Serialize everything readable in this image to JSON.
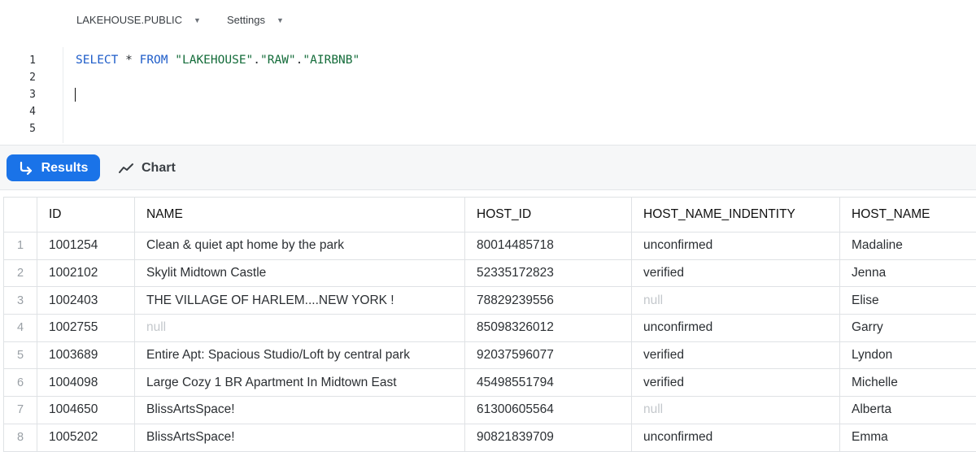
{
  "context": {
    "database_schema": "LAKEHOUSE.PUBLIC",
    "settings_label": "Settings"
  },
  "editor": {
    "line_numbers": [
      "1",
      "2",
      "3",
      "4",
      "5"
    ],
    "query": {
      "select": "SELECT",
      "star": "*",
      "from": "FROM",
      "db": "\"LAKEHOUSE\"",
      "dot": ".",
      "schema": "\"RAW\"",
      "table": "\"AIRBNB\""
    }
  },
  "tabs": {
    "results_label": "Results",
    "chart_label": "Chart"
  },
  "table": {
    "columns": [
      "ID",
      "NAME",
      "HOST_ID",
      "HOST_NAME_INDENTITY",
      "HOST_NAME"
    ],
    "rows": [
      {
        "n": "1",
        "id": "1001254",
        "name": "Clean & quiet apt home by the park",
        "host_id": "80014485718",
        "identity": "unconfirmed",
        "host_name": "Madaline"
      },
      {
        "n": "2",
        "id": "1002102",
        "name": "Skylit Midtown Castle",
        "host_id": "52335172823",
        "identity": "verified",
        "host_name": "Jenna"
      },
      {
        "n": "3",
        "id": "1002403",
        "name": "THE VILLAGE OF HARLEM....NEW YORK !",
        "host_id": "78829239556",
        "identity": "null",
        "host_name": "Elise"
      },
      {
        "n": "4",
        "id": "1002755",
        "name": "null",
        "host_id": "85098326012",
        "identity": "unconfirmed",
        "host_name": "Garry"
      },
      {
        "n": "5",
        "id": "1003689",
        "name": "Entire Apt: Spacious Studio/Loft by central park",
        "host_id": "92037596077",
        "identity": "verified",
        "host_name": "Lyndon"
      },
      {
        "n": "6",
        "id": "1004098",
        "name": "Large Cozy 1 BR Apartment In Midtown East",
        "host_id": "45498551794",
        "identity": "verified",
        "host_name": "Michelle"
      },
      {
        "n": "7",
        "id": "1004650",
        "name": "BlissArtsSpace!",
        "host_id": "61300605564",
        "identity": "null",
        "host_name": "Alberta"
      },
      {
        "n": "8",
        "id": "1005202",
        "name": "BlissArtsSpace!",
        "host_id": "90821839709",
        "identity": "unconfirmed",
        "host_name": "Emma"
      }
    ]
  }
}
